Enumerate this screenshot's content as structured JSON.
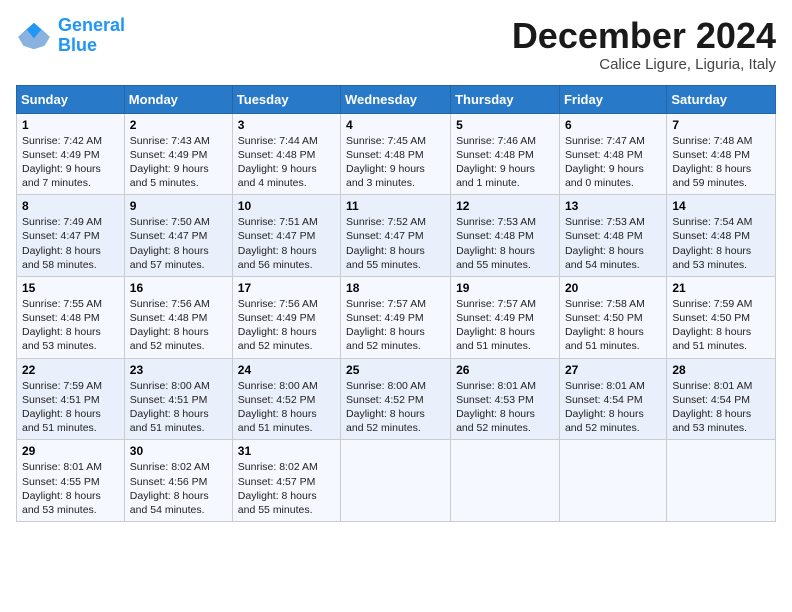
{
  "logo": {
    "line1": "General",
    "line2": "Blue"
  },
  "title": "December 2024",
  "subtitle": "Calice Ligure, Liguria, Italy",
  "days_of_week": [
    "Sunday",
    "Monday",
    "Tuesday",
    "Wednesday",
    "Thursday",
    "Friday",
    "Saturday"
  ],
  "weeks": [
    [
      {
        "day": "1",
        "info": "Sunrise: 7:42 AM\nSunset: 4:49 PM\nDaylight: 9 hours and 7 minutes."
      },
      {
        "day": "2",
        "info": "Sunrise: 7:43 AM\nSunset: 4:49 PM\nDaylight: 9 hours and 5 minutes."
      },
      {
        "day": "3",
        "info": "Sunrise: 7:44 AM\nSunset: 4:48 PM\nDaylight: 9 hours and 4 minutes."
      },
      {
        "day": "4",
        "info": "Sunrise: 7:45 AM\nSunset: 4:48 PM\nDaylight: 9 hours and 3 minutes."
      },
      {
        "day": "5",
        "info": "Sunrise: 7:46 AM\nSunset: 4:48 PM\nDaylight: 9 hours and 1 minute."
      },
      {
        "day": "6",
        "info": "Sunrise: 7:47 AM\nSunset: 4:48 PM\nDaylight: 9 hours and 0 minutes."
      },
      {
        "day": "7",
        "info": "Sunrise: 7:48 AM\nSunset: 4:48 PM\nDaylight: 8 hours and 59 minutes."
      }
    ],
    [
      {
        "day": "8",
        "info": "Sunrise: 7:49 AM\nSunset: 4:47 PM\nDaylight: 8 hours and 58 minutes."
      },
      {
        "day": "9",
        "info": "Sunrise: 7:50 AM\nSunset: 4:47 PM\nDaylight: 8 hours and 57 minutes."
      },
      {
        "day": "10",
        "info": "Sunrise: 7:51 AM\nSunset: 4:47 PM\nDaylight: 8 hours and 56 minutes."
      },
      {
        "day": "11",
        "info": "Sunrise: 7:52 AM\nSunset: 4:47 PM\nDaylight: 8 hours and 55 minutes."
      },
      {
        "day": "12",
        "info": "Sunrise: 7:53 AM\nSunset: 4:48 PM\nDaylight: 8 hours and 55 minutes."
      },
      {
        "day": "13",
        "info": "Sunrise: 7:53 AM\nSunset: 4:48 PM\nDaylight: 8 hours and 54 minutes."
      },
      {
        "day": "14",
        "info": "Sunrise: 7:54 AM\nSunset: 4:48 PM\nDaylight: 8 hours and 53 minutes."
      }
    ],
    [
      {
        "day": "15",
        "info": "Sunrise: 7:55 AM\nSunset: 4:48 PM\nDaylight: 8 hours and 53 minutes."
      },
      {
        "day": "16",
        "info": "Sunrise: 7:56 AM\nSunset: 4:48 PM\nDaylight: 8 hours and 52 minutes."
      },
      {
        "day": "17",
        "info": "Sunrise: 7:56 AM\nSunset: 4:49 PM\nDaylight: 8 hours and 52 minutes."
      },
      {
        "day": "18",
        "info": "Sunrise: 7:57 AM\nSunset: 4:49 PM\nDaylight: 8 hours and 52 minutes."
      },
      {
        "day": "19",
        "info": "Sunrise: 7:57 AM\nSunset: 4:49 PM\nDaylight: 8 hours and 51 minutes."
      },
      {
        "day": "20",
        "info": "Sunrise: 7:58 AM\nSunset: 4:50 PM\nDaylight: 8 hours and 51 minutes."
      },
      {
        "day": "21",
        "info": "Sunrise: 7:59 AM\nSunset: 4:50 PM\nDaylight: 8 hours and 51 minutes."
      }
    ],
    [
      {
        "day": "22",
        "info": "Sunrise: 7:59 AM\nSunset: 4:51 PM\nDaylight: 8 hours and 51 minutes."
      },
      {
        "day": "23",
        "info": "Sunrise: 8:00 AM\nSunset: 4:51 PM\nDaylight: 8 hours and 51 minutes."
      },
      {
        "day": "24",
        "info": "Sunrise: 8:00 AM\nSunset: 4:52 PM\nDaylight: 8 hours and 51 minutes."
      },
      {
        "day": "25",
        "info": "Sunrise: 8:00 AM\nSunset: 4:52 PM\nDaylight: 8 hours and 52 minutes."
      },
      {
        "day": "26",
        "info": "Sunrise: 8:01 AM\nSunset: 4:53 PM\nDaylight: 8 hours and 52 minutes."
      },
      {
        "day": "27",
        "info": "Sunrise: 8:01 AM\nSunset: 4:54 PM\nDaylight: 8 hours and 52 minutes."
      },
      {
        "day": "28",
        "info": "Sunrise: 8:01 AM\nSunset: 4:54 PM\nDaylight: 8 hours and 53 minutes."
      }
    ],
    [
      {
        "day": "29",
        "info": "Sunrise: 8:01 AM\nSunset: 4:55 PM\nDaylight: 8 hours and 53 minutes."
      },
      {
        "day": "30",
        "info": "Sunrise: 8:02 AM\nSunset: 4:56 PM\nDaylight: 8 hours and 54 minutes."
      },
      {
        "day": "31",
        "info": "Sunrise: 8:02 AM\nSunset: 4:57 PM\nDaylight: 8 hours and 55 minutes."
      },
      null,
      null,
      null,
      null
    ]
  ]
}
